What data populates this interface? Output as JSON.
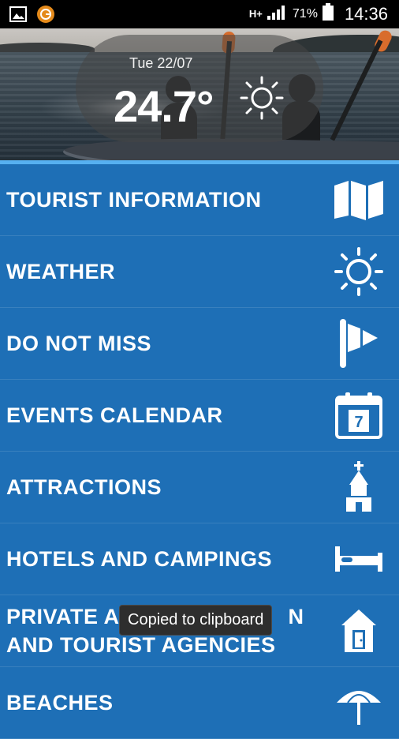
{
  "status_bar": {
    "network": "H+",
    "battery": "71%",
    "time": "14:36",
    "icons": [
      "image-notification-icon",
      "app-notification-icon",
      "signal-icon",
      "battery-icon"
    ]
  },
  "hero": {
    "date": "Tue 22/07",
    "temperature": "24.7°",
    "weather_icon": "sun-icon"
  },
  "menu": {
    "items": [
      {
        "label": "TOURIST INFORMATION",
        "icon": "map-icon"
      },
      {
        "label": "WEATHER",
        "icon": "sun-icon"
      },
      {
        "label": "DO NOT MISS",
        "icon": "flag-icon"
      },
      {
        "label": "EVENTS CALENDAR",
        "icon": "calendar-icon",
        "icon_text": "7"
      },
      {
        "label": "ATTRACTIONS",
        "icon": "church-icon"
      },
      {
        "label": "HOTELS AND CAMPINGS",
        "icon": "bed-icon"
      },
      {
        "label": "PRIVATE AC",
        "label_tail": "N",
        "label_line2": "AND TOURIST AGENCIES",
        "icon": "house-icon"
      },
      {
        "label": "BEACHES",
        "icon": "umbrella-icon"
      }
    ]
  },
  "toast": {
    "text": "Copied to clipboard"
  },
  "colors": {
    "menu_background": "#1e6fb6",
    "accent_line": "#56b0f1",
    "status_bar": "#000000"
  }
}
